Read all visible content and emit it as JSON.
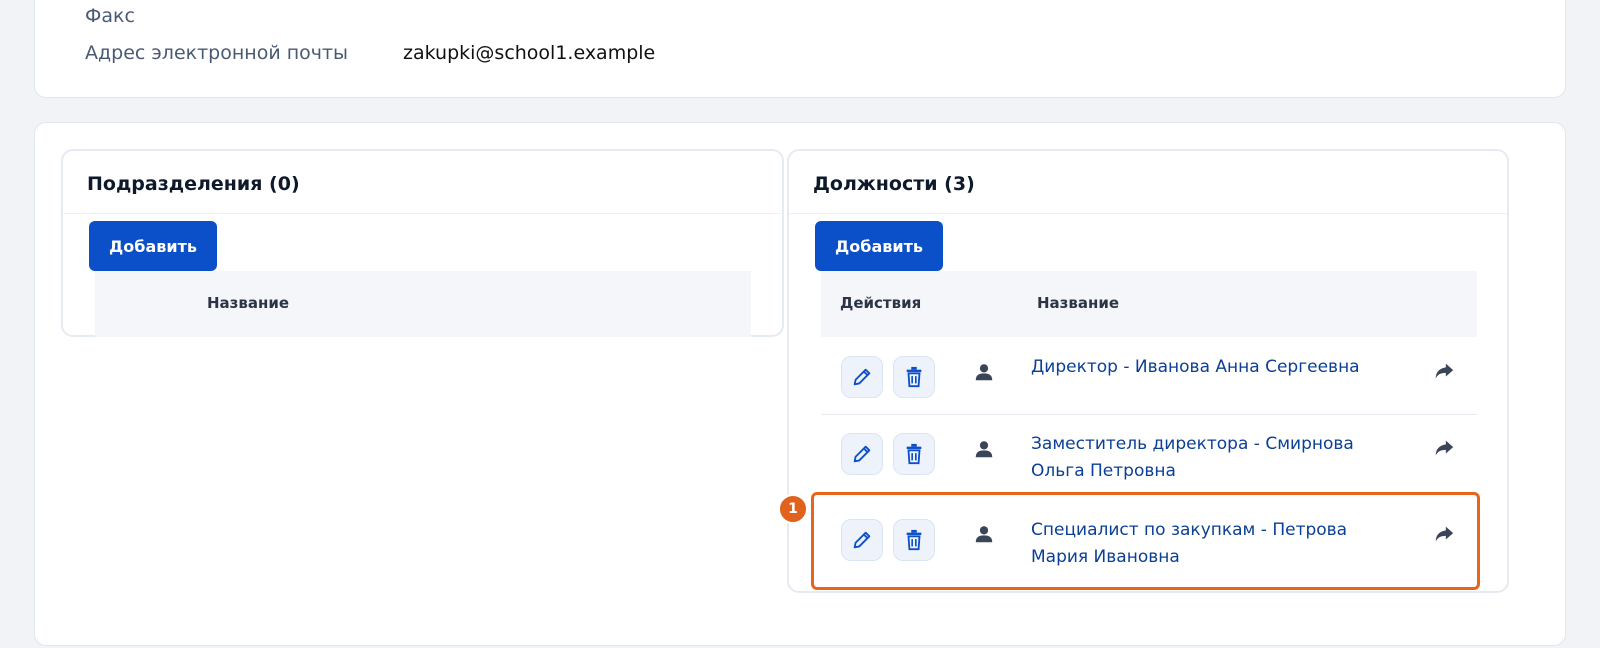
{
  "contacts": {
    "fax_label": "Факс",
    "fax_value": "",
    "email_label": "Адрес электронной почты",
    "email_value": "zakupki@school1.example"
  },
  "departments": {
    "title": "Подразделения (0)",
    "add_label": "Добавить",
    "col_name": "Название"
  },
  "positions": {
    "title": "Должности (3)",
    "add_label": "Добавить",
    "col_actions": "Действия",
    "col_name": "Название",
    "rows": [
      {
        "name_line1": "Директор - Иванова Анна Сергеевна",
        "name_line2": ""
      },
      {
        "name_line1": "Заместитель директора - Смирнова",
        "name_line2": "Ольга Петровна"
      },
      {
        "name_line1": "Специалист по закупкам - Петрова",
        "name_line2": "Мария Ивановна"
      }
    ]
  },
  "annotation": {
    "marker_label": "1"
  },
  "colors": {
    "accent": "#0b50c8",
    "link": "#0b3f95",
    "highlight": "#e8661c",
    "icon": "#0b50c8"
  },
  "icons": [
    "pencil-icon",
    "trash-icon",
    "person-icon",
    "share-icon"
  ]
}
